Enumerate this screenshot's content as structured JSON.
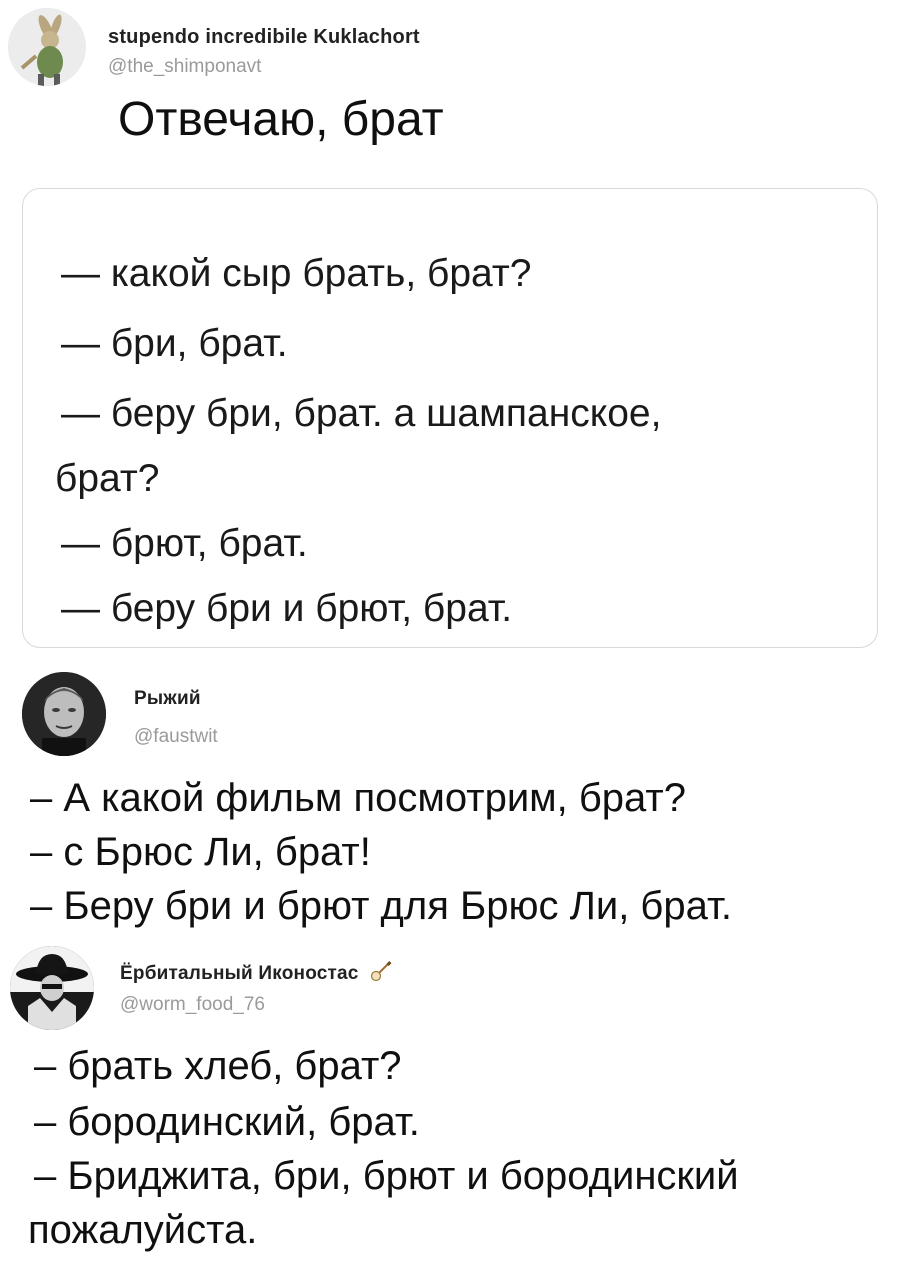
{
  "post1": {
    "author_name": "stupendo incredibile Kuklachort",
    "handle": "@the_shimponavt",
    "text": "Отвечаю, брат",
    "quote_lines": [
      "— какой сыр брать, брат?",
      "— бри, брат.",
      "— беру бри, брат. а шампанское,",
      "брат?",
      "— брют, брат.",
      "— беру бри и брют, брат."
    ]
  },
  "post2": {
    "author_name": "Рыжий",
    "handle": "@faustwit",
    "lines": [
      "– А какой фильм посмотрим, брат?",
      "– с Брюс Ли, брат!",
      "– Беру бри и брют для Брюс Ли, брат."
    ]
  },
  "post3": {
    "author_name": "Ёрбитальный Иконостас",
    "name_icon": "banjo-icon",
    "handle": "@worm_food_76",
    "lines": [
      "– брать хлеб, брат?",
      "– бородинский, брат.",
      "– Бриджита, бри, брют и бородинский",
      "пожалуйста."
    ]
  }
}
